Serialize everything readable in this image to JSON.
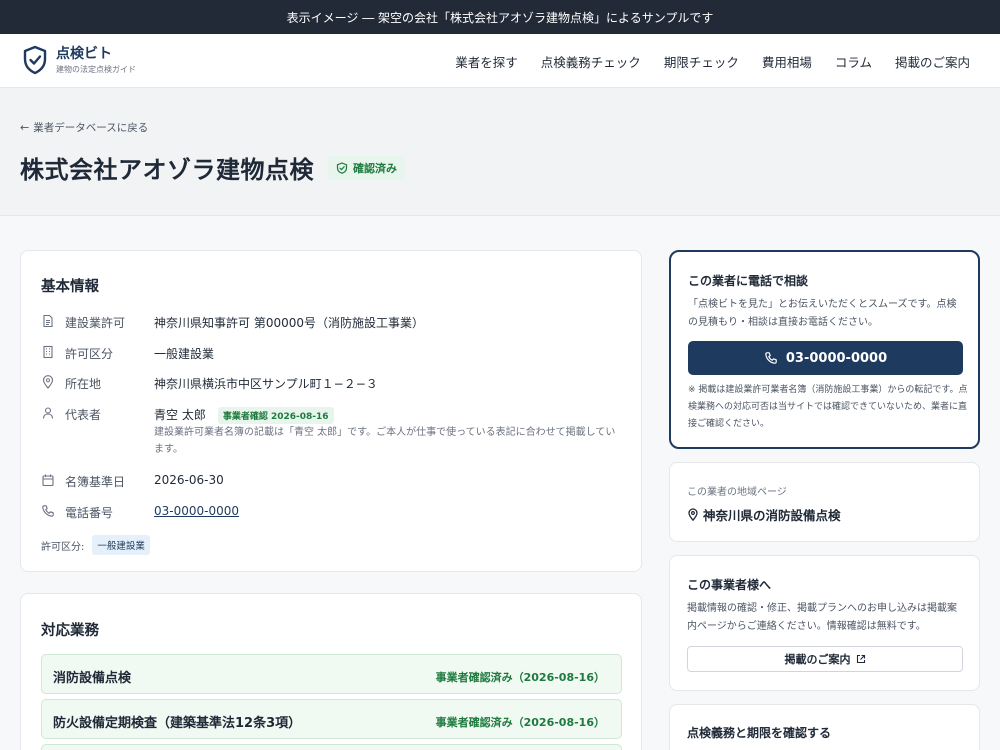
{
  "topbar": {
    "notice": "表示イメージ ― 架空の会社「株式会社アオゾラ建物点検」によるサンプルです"
  },
  "brand": {
    "name": "点検ビト",
    "tagline": "建物の法定点検ガイド"
  },
  "nav": {
    "items": [
      {
        "label": "業者を探す"
      },
      {
        "label": "点検義務チェック"
      },
      {
        "label": "期限チェック"
      },
      {
        "label": "費用相場"
      },
      {
        "label": "コラム"
      },
      {
        "label": "掲載のご案内"
      }
    ]
  },
  "hero": {
    "back_link": "業者データベースに戻る",
    "company_name": "株式会社アオゾラ建物点検",
    "verified_badge": "確認済み"
  },
  "basic_info": {
    "heading": "基本情報",
    "rows": [
      {
        "icon": "document-icon",
        "label": "建設業許可",
        "value": "神奈川県知事許可 第00000号（消防施設工事業）"
      },
      {
        "icon": "building-icon",
        "label": "許可区分",
        "value": "一般建設業"
      },
      {
        "icon": "location-pin-icon",
        "label": "所在地",
        "value": "神奈川県横浜市中区サンプル町１−２−３"
      },
      {
        "icon": "person-icon",
        "label": "代表者",
        "value": "青空 太郎",
        "badge": "事業者確認 2026-08-16",
        "note": "建設業許可業者名簿の記載は「青空 太郎」です。ご本人が仕事で使っている表記に合わせて掲載しています。"
      },
      {
        "icon": "calendar-icon",
        "label": "名簿基準日",
        "value": "2026-06-30"
      },
      {
        "icon": "phone-icon",
        "label": "電話番号",
        "value": "03-0000-0000"
      }
    ],
    "license_label": "許可区分:",
    "license_tag": "一般建設業"
  },
  "services": {
    "heading": "対応業務",
    "items": [
      {
        "name": "消防設備点検",
        "status": "事業者確認済み（2026-08-16）"
      },
      {
        "name": "防火設備定期検査（建築基準法12条3項）",
        "status": "事業者確認済み（2026-08-16）"
      }
    ]
  },
  "call_card": {
    "heading": "この業者に電話で相談",
    "text": "「点検ビトを見た」とお伝えいただくとスムーズです。点検の見積もり・相談は直接お電話ください。",
    "phone": "03-0000-0000",
    "note": "※ 掲載は建設業許可業者名簿（消防施設工事業）からの転記です。点検業務への対応可否は当サイトでは確認できていないため、業者に直接ご確認ください。"
  },
  "region_card": {
    "caption": "この業者の地域ページ",
    "link": "神奈川県の消防設備点検"
  },
  "owner_card": {
    "heading": "この事業者様へ",
    "text": "掲載情報の確認・修正、掲載プランへのお申し込みは掲載案内ページからご連絡ください。情報確認は無料です。",
    "button": "掲載のご案内"
  },
  "check_card": {
    "heading": "点検義務と期限を確認する"
  },
  "colors": {
    "navy": "#1e3a5f",
    "topbar": "#222a38",
    "green": "#1e7a3e",
    "green_bg": "#e8f5ec"
  }
}
